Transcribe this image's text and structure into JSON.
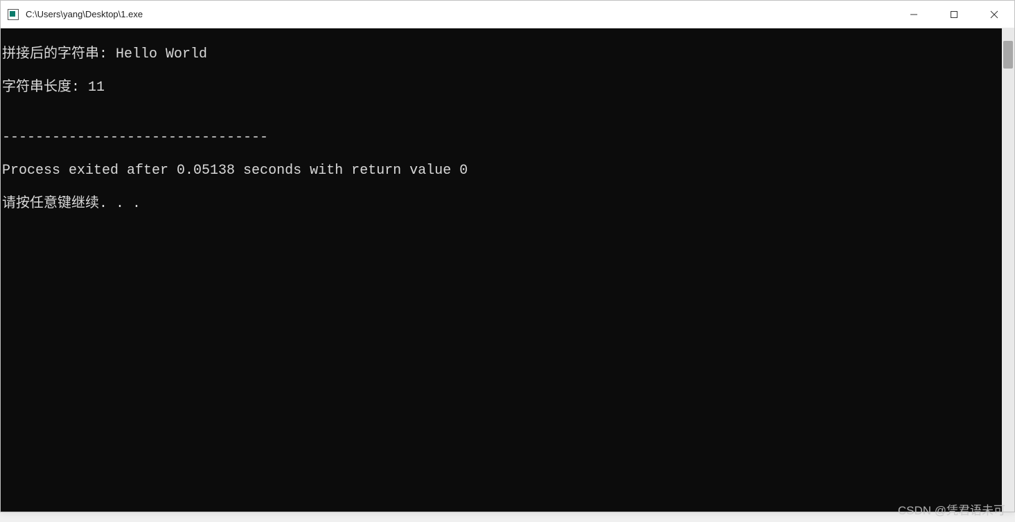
{
  "window": {
    "title": "C:\\Users\\yang\\Desktop\\1.exe"
  },
  "console": {
    "line1": "拼接后的字符串: Hello World",
    "line2": "字符串长度: 11",
    "line3": "",
    "line4": "--------------------------------",
    "line5": "Process exited after 0.05138 seconds with return value 0",
    "line6": "请按任意键继续. . ."
  },
  "watermark": "CSDN @凭君语未可"
}
